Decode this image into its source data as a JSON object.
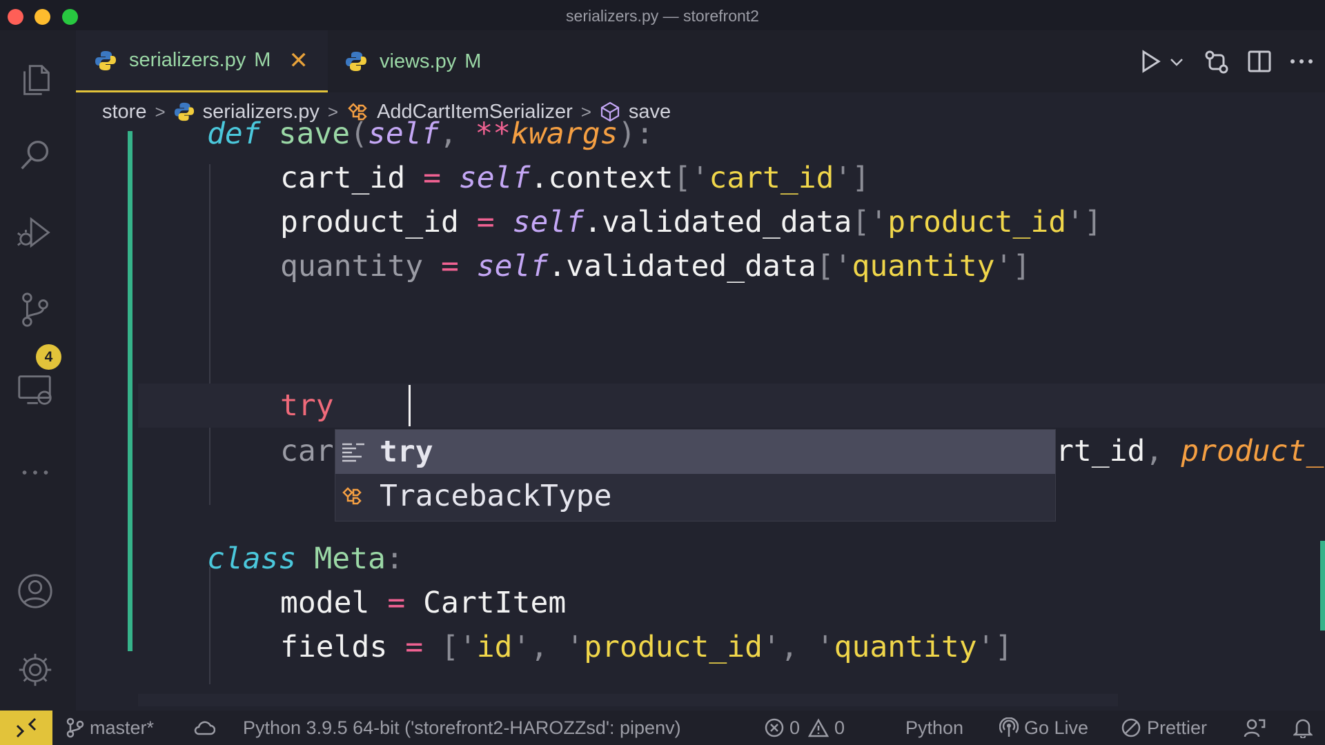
{
  "window": {
    "title": "serializers.py — storefront2"
  },
  "activity": {
    "items": [
      "Explorer",
      "Search",
      "Run and Debug",
      "Source Control",
      "Remote Explorer",
      "More",
      "Accounts",
      "Manage"
    ],
    "source_control_badge": "4"
  },
  "tabs": [
    {
      "label": "serializers.py",
      "status": "M",
      "active": true
    },
    {
      "label": "views.py",
      "status": "M",
      "active": false
    }
  ],
  "breadcrumbs": {
    "folder": "store",
    "file": "serializers.py",
    "class": "AddCartItemSerializer",
    "method": "save"
  },
  "code": {
    "l1": {
      "kw": "def",
      "fn": "save",
      "p1": "(",
      "self": "self",
      "comma": ",",
      "op": "**",
      "param": "kwargs",
      "p2": "):"
    },
    "l2": {
      "var": "cart_id",
      "eq": "=",
      "self": "self",
      "attr": ".context",
      "open": "['",
      "str": "cart_id",
      "close": "']"
    },
    "l3": {
      "var": "product_id",
      "eq": "=",
      "self": "self",
      "attr": ".validated_data",
      "open": "['",
      "str": "product_id",
      "close": "']"
    },
    "l4": {
      "var": "quantity",
      "eq": "=",
      "self": "self",
      "attr": ".validated_data",
      "open": "['",
      "str": "quantity",
      "close": "']"
    },
    "l5": {
      "typed": "try"
    },
    "l6": {
      "left": "car",
      "right": "rt_id",
      "comma": ",",
      "param": "product_"
    },
    "l7": {
      "kw": "class",
      "name": "Meta",
      "colon": ":"
    },
    "l8": {
      "var": "model",
      "eq": "=",
      "val": "CartItem"
    },
    "l9": {
      "var": "fields",
      "eq": "=",
      "open": "['",
      "s1": "id",
      "sep1": "', '",
      "s2": "product_id",
      "sep2": "', '",
      "s3": "quantity",
      "close": "']"
    }
  },
  "suggestions": [
    {
      "label": "try",
      "icon": "snippet-icon",
      "selected": true
    },
    {
      "label": "TracebackType",
      "icon": "class-icon",
      "selected": false
    }
  ],
  "status": {
    "branch": "master*",
    "interpreter": "Python 3.9.5 64-bit ('storefront2-HAROZZsd': pipenv)",
    "errors": "0",
    "warnings": "0",
    "language": "Python",
    "go_live": "Go Live",
    "prettier": "Prettier"
  },
  "colors": {
    "accent": "#e2c33a",
    "git_added": "#36b38a",
    "background": "#22232e"
  }
}
